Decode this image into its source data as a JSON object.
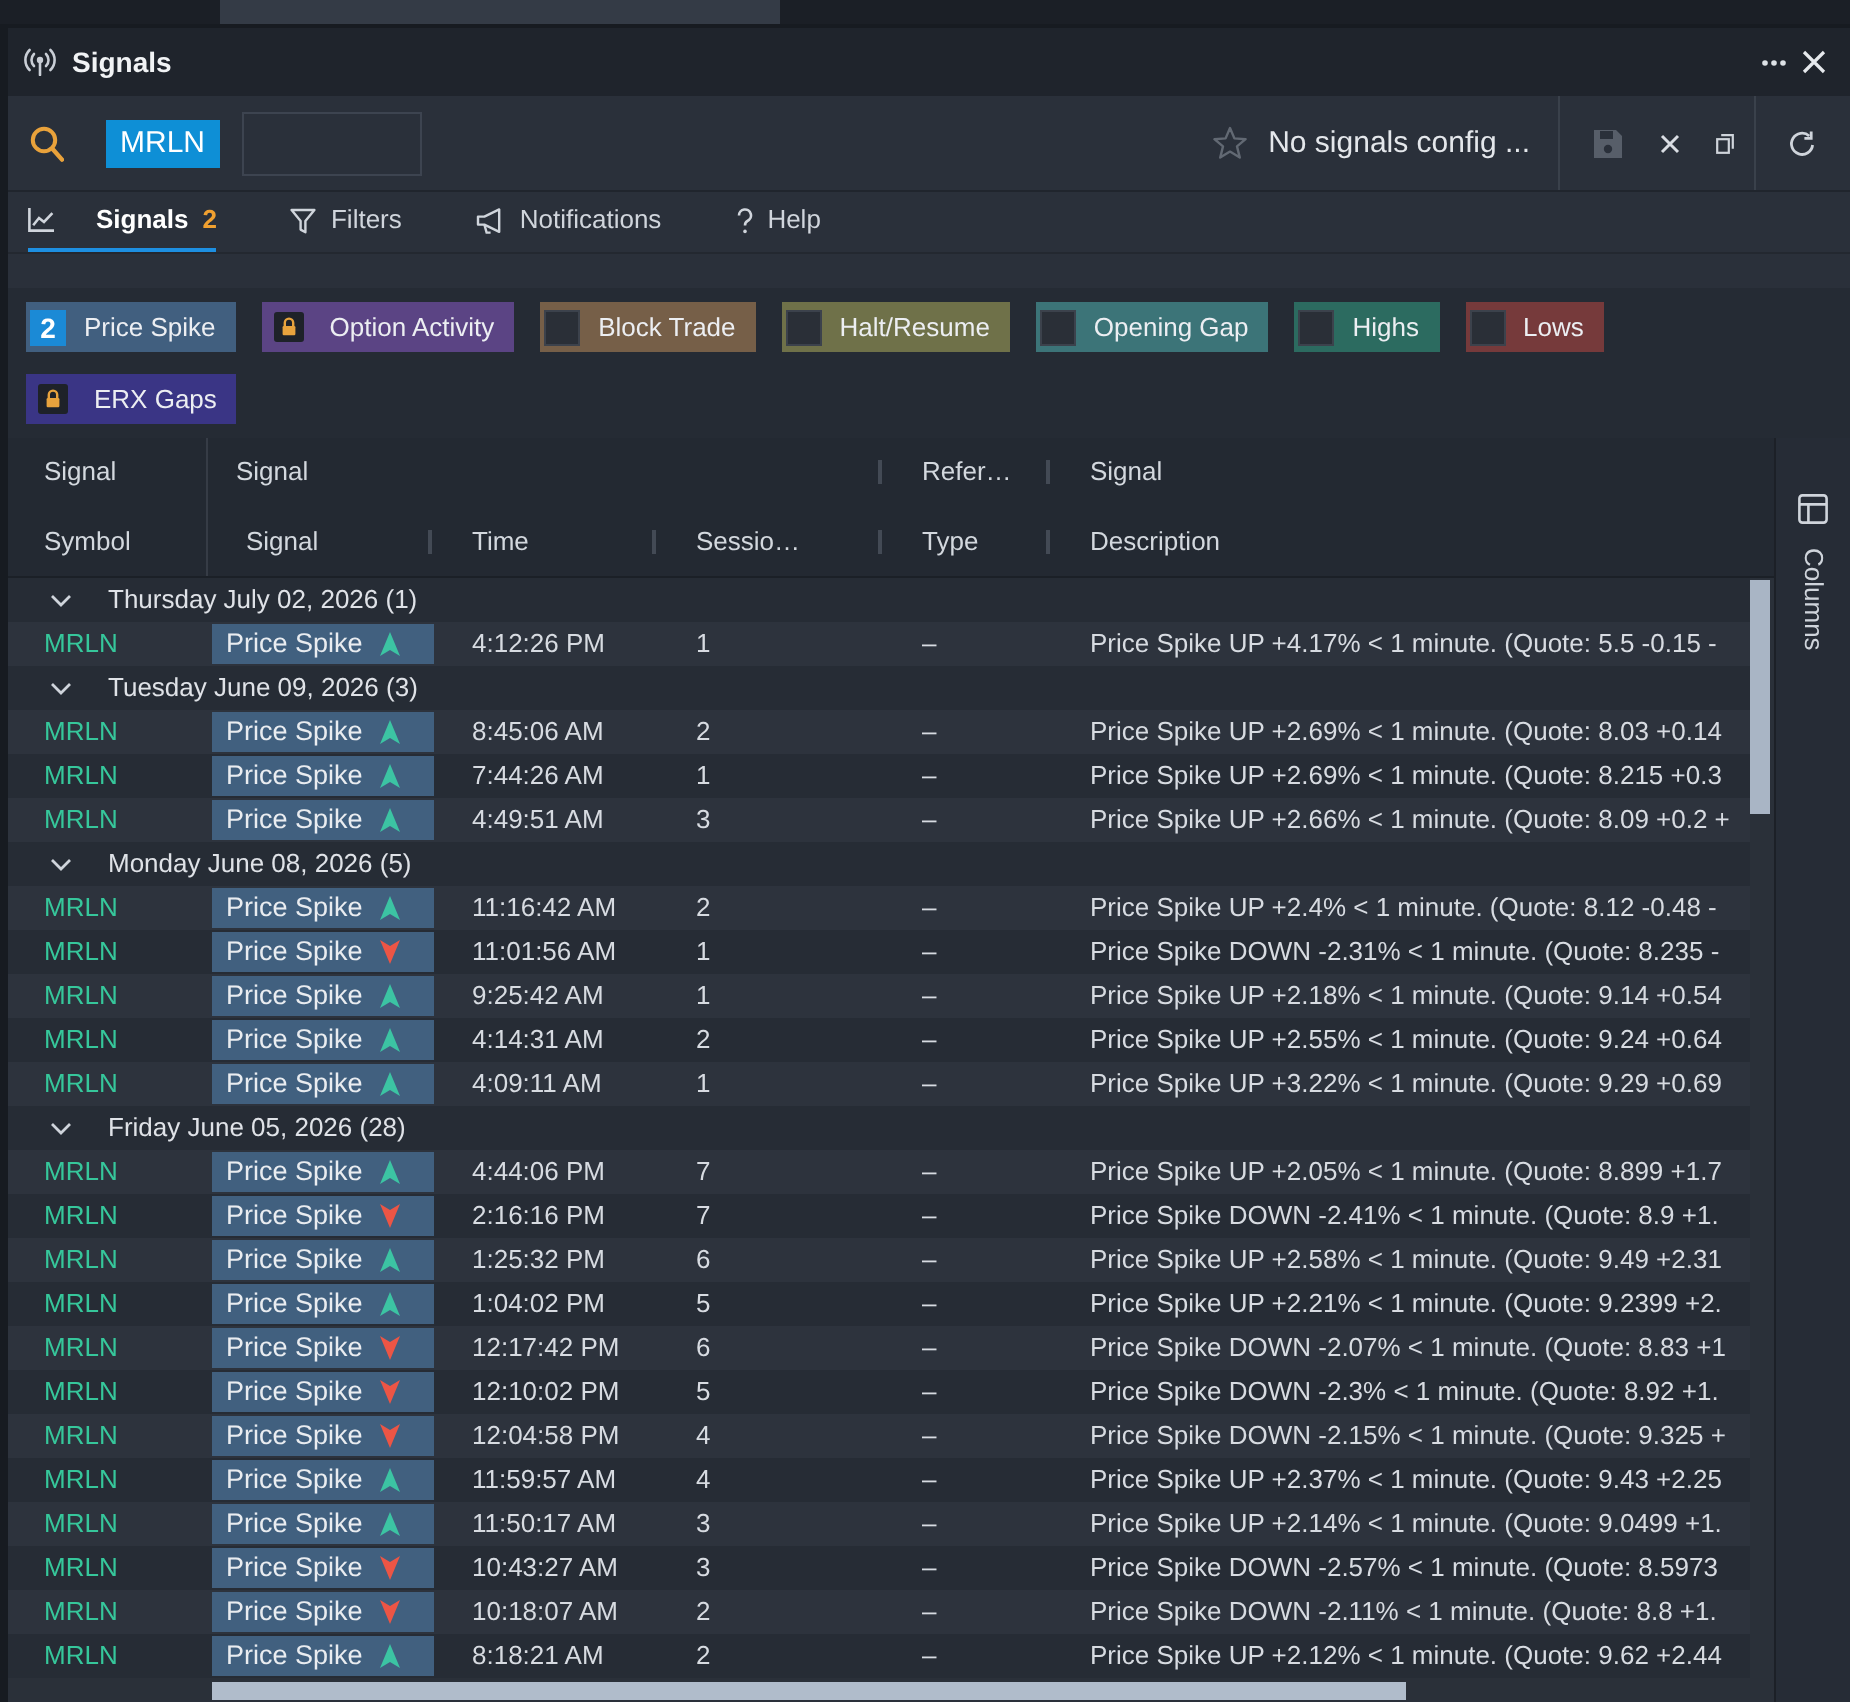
{
  "window": {
    "title": "Signals"
  },
  "toolbar": {
    "symbol": "MRLN",
    "config": "No signals config ...",
    "save": {
      "disabled": true
    }
  },
  "tabs": [
    {
      "label": "Signals",
      "selected": true,
      "count": "2"
    },
    {
      "label": "Filters",
      "selected": false
    },
    {
      "label": "Notifications",
      "selected": false
    },
    {
      "label": "Help",
      "selected": false
    }
  ],
  "signal_types": [
    {
      "kind": "count",
      "label": "Price Spike",
      "count": "2",
      "color": "#415f7f"
    },
    {
      "kind": "locked",
      "label": "Option Activity",
      "color": "#5b4484"
    },
    {
      "kind": "checkbox",
      "label": "Block Trade",
      "checked": false,
      "color": "#765f48"
    },
    {
      "kind": "checkbox",
      "label": "Halt/Resume",
      "checked": false,
      "color": "#6f7149"
    },
    {
      "kind": "checkbox",
      "label": "Opening Gap",
      "checked": false,
      "color": "#3c7478"
    },
    {
      "kind": "checkbox",
      "label": "Highs",
      "checked": false,
      "color": "#2c6b60"
    },
    {
      "kind": "checkbox",
      "label": "Lows",
      "checked": false,
      "color": "#763a3b"
    },
    {
      "kind": "locked",
      "label": "ERX Gaps",
      "color": "#3a3585"
    }
  ],
  "table": {
    "header_groups": [
      "Signal",
      "Signal",
      "Refer…",
      "Signal"
    ],
    "columns": [
      "Symbol",
      "Signal",
      "Time",
      "Sessio…",
      "Type",
      "Description"
    ],
    "groups": [
      {
        "label": "Thursday July 02, 2026 (1)",
        "expanded": true,
        "rows": [
          {
            "symbol": "MRLN",
            "signal": "Price Spike",
            "up": true,
            "time": "4:12:26 PM",
            "session": "1",
            "type": "–",
            "description": "Price Spike UP +4.17% < 1 minute. (Quote: 5.5 -0.15 -"
          }
        ]
      },
      {
        "label": "Tuesday June 09, 2026 (3)",
        "expanded": true,
        "rows": [
          {
            "symbol": "MRLN",
            "signal": "Price Spike",
            "up": true,
            "time": "8:45:06 AM",
            "session": "2",
            "type": "–",
            "description": "Price Spike UP +2.69% < 1 minute. (Quote: 8.03 +0.14"
          },
          {
            "symbol": "MRLN",
            "signal": "Price Spike",
            "up": true,
            "time": "7:44:26 AM",
            "session": "1",
            "type": "–",
            "description": "Price Spike UP +2.69% < 1 minute. (Quote: 8.215 +0.3"
          },
          {
            "symbol": "MRLN",
            "signal": "Price Spike",
            "up": true,
            "time": "4:49:51 AM",
            "session": "3",
            "type": "–",
            "description": "Price Spike UP +2.66% < 1 minute. (Quote: 8.09 +0.2 +"
          }
        ]
      },
      {
        "label": "Monday June 08, 2026 (5)",
        "expanded": true,
        "rows": [
          {
            "symbol": "MRLN",
            "signal": "Price Spike",
            "up": true,
            "time": "11:16:42 AM",
            "session": "2",
            "type": "–",
            "description": "Price Spike UP +2.4% < 1 minute. (Quote: 8.12 -0.48 -"
          },
          {
            "symbol": "MRLN",
            "signal": "Price Spike",
            "up": false,
            "time": "11:01:56 AM",
            "session": "1",
            "type": "–",
            "description": "Price Spike DOWN -2.31% < 1 minute. (Quote: 8.235 -"
          },
          {
            "symbol": "MRLN",
            "signal": "Price Spike",
            "up": true,
            "time": "9:25:42 AM",
            "session": "1",
            "type": "–",
            "description": "Price Spike UP +2.18% < 1 minute. (Quote: 9.14 +0.54"
          },
          {
            "symbol": "MRLN",
            "signal": "Price Spike",
            "up": true,
            "time": "4:14:31 AM",
            "session": "2",
            "type": "–",
            "description": "Price Spike UP +2.55% < 1 minute. (Quote: 9.24 +0.64"
          },
          {
            "symbol": "MRLN",
            "signal": "Price Spike",
            "up": true,
            "time": "4:09:11 AM",
            "session": "1",
            "type": "–",
            "description": "Price Spike UP +3.22% < 1 minute. (Quote: 9.29 +0.69"
          }
        ]
      },
      {
        "label": "Friday June 05, 2026 (28)",
        "expanded": true,
        "rows": [
          {
            "symbol": "MRLN",
            "signal": "Price Spike",
            "up": true,
            "time": "4:44:06 PM",
            "session": "7",
            "type": "–",
            "description": "Price Spike UP +2.05% < 1 minute. (Quote: 8.899 +1.7"
          },
          {
            "symbol": "MRLN",
            "signal": "Price Spike",
            "up": false,
            "time": "2:16:16 PM",
            "session": "7",
            "type": "–",
            "description": "Price Spike DOWN -2.41% < 1 minute. (Quote: 8.9 +1."
          },
          {
            "symbol": "MRLN",
            "signal": "Price Spike",
            "up": true,
            "time": "1:25:32 PM",
            "session": "6",
            "type": "–",
            "description": "Price Spike UP +2.58% < 1 minute. (Quote: 9.49 +2.31"
          },
          {
            "symbol": "MRLN",
            "signal": "Price Spike",
            "up": true,
            "time": "1:04:02 PM",
            "session": "5",
            "type": "–",
            "description": "Price Spike UP +2.21% < 1 minute. (Quote: 9.2399 +2."
          },
          {
            "symbol": "MRLN",
            "signal": "Price Spike",
            "up": false,
            "time": "12:17:42 PM",
            "session": "6",
            "type": "–",
            "description": "Price Spike DOWN -2.07% < 1 minute. (Quote: 8.83 +1"
          },
          {
            "symbol": "MRLN",
            "signal": "Price Spike",
            "up": false,
            "time": "12:10:02 PM",
            "session": "5",
            "type": "–",
            "description": "Price Spike DOWN -2.3% < 1 minute. (Quote: 8.92 +1."
          },
          {
            "symbol": "MRLN",
            "signal": "Price Spike",
            "up": false,
            "time": "12:04:58 PM",
            "session": "4",
            "type": "–",
            "description": "Price Spike DOWN -2.15% < 1 minute. (Quote: 9.325 +"
          },
          {
            "symbol": "MRLN",
            "signal": "Price Spike",
            "up": true,
            "time": "11:59:57 AM",
            "session": "4",
            "type": "–",
            "description": "Price Spike UP +2.37% < 1 minute. (Quote: 9.43 +2.25"
          },
          {
            "symbol": "MRLN",
            "signal": "Price Spike",
            "up": true,
            "time": "11:50:17 AM",
            "session": "3",
            "type": "–",
            "description": "Price Spike UP +2.14% < 1 minute. (Quote: 9.0499 +1."
          },
          {
            "symbol": "MRLN",
            "signal": "Price Spike",
            "up": false,
            "time": "10:43:27 AM",
            "session": "3",
            "type": "–",
            "description": "Price Spike DOWN -2.57% < 1 minute. (Quote: 8.5973"
          },
          {
            "symbol": "MRLN",
            "signal": "Price Spike",
            "up": false,
            "time": "10:18:07 AM",
            "session": "2",
            "type": "–",
            "description": "Price Spike DOWN -2.11% < 1 minute. (Quote: 8.8 +1."
          },
          {
            "symbol": "MRLN",
            "signal": "Price Spike",
            "up": true,
            "time": "8:18:21 AM",
            "session": "2",
            "type": "–",
            "description": "Price Spike UP +2.12% < 1 minute. (Quote: 9.62 +2.44"
          }
        ]
      }
    ]
  },
  "side_panel": {
    "label": "Columns"
  }
}
